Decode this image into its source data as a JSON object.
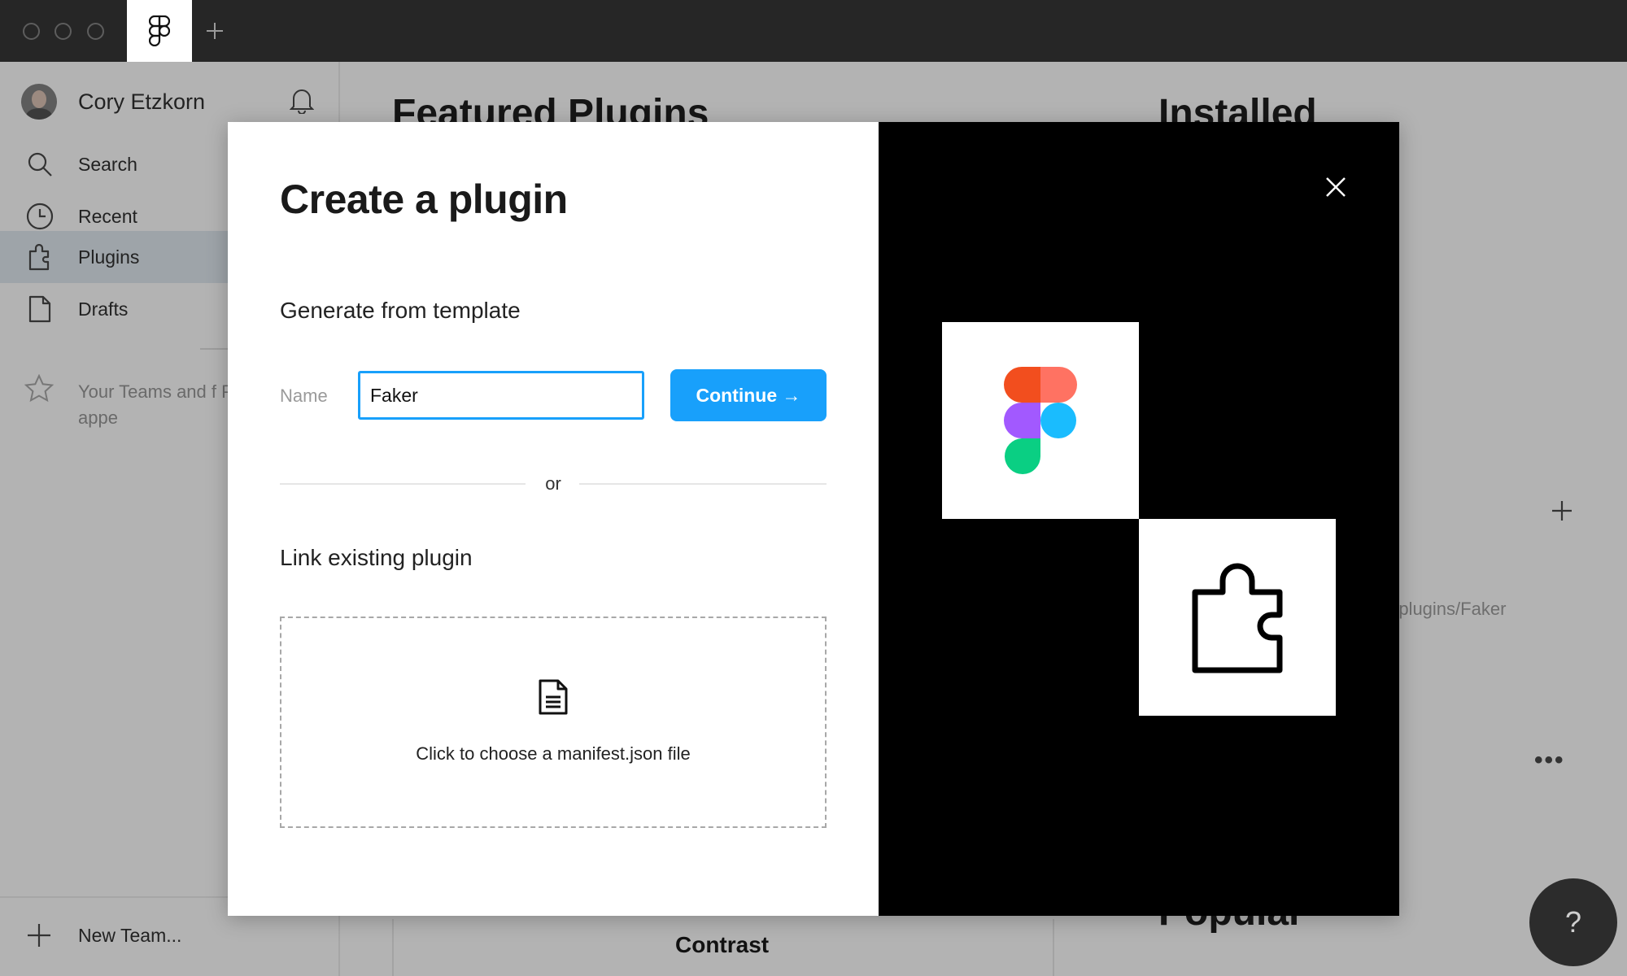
{
  "sidebar": {
    "user_name": "Cory Etzkorn",
    "nav": [
      {
        "label": "Search",
        "icon": "search-icon"
      },
      {
        "label": "Recent",
        "icon": "clock-icon"
      },
      {
        "label": "Plugins",
        "icon": "plugin-icon",
        "active": true
      },
      {
        "label": "Drafts",
        "icon": "file-icon"
      }
    ],
    "teams_text": "Your Teams and f Projects will appe",
    "new_team_label": "New Team..."
  },
  "main": {
    "featured_heading": "Featured Plugins",
    "installed_heading": "Installed",
    "popular_heading": "Popular",
    "path_text": "-plugins/Faker",
    "contrast_label": "Contrast",
    "more_label": "•••",
    "help_label": "?"
  },
  "modal": {
    "title": "Create a plugin",
    "generate_title": "Generate from template",
    "name_label": "Name",
    "name_value": "Faker",
    "continue_label": "Continue →",
    "or_text": "or",
    "link_title": "Link existing plugin",
    "drop_text": "Click to choose a manifest.json file"
  },
  "colors": {
    "accent": "#18a0fb",
    "titlebar": "#262626",
    "figma_red": "#f24e1e",
    "figma_salmon": "#ff7262",
    "figma_purple": "#a259ff",
    "figma_blue": "#1abcfe",
    "figma_green": "#0acf83"
  }
}
